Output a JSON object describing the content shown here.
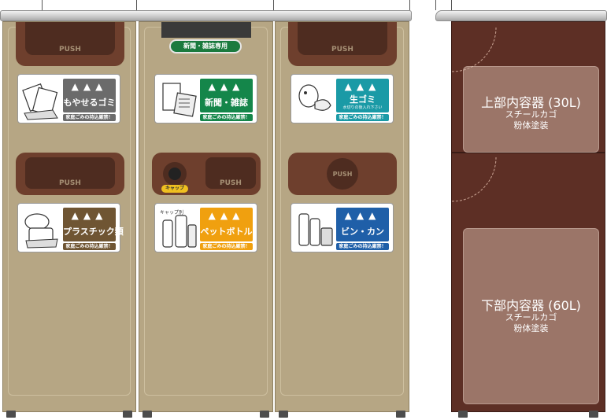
{
  "units": [
    {
      "id": "burnable",
      "upper_push": "PUSH",
      "lower_push": "PUSH",
      "label_text": "もやせるゴミ",
      "label_color": "#6b6b6b",
      "label_foot": "家庭ごみの持込厳禁！"
    },
    {
      "id": "newspaper",
      "tag": "新聞・雑誌専用",
      "cap_tag": "キャップ",
      "lower_push": "PUSH",
      "upper_label_text": "新聞・雑誌",
      "upper_label_color": "#14864a",
      "upper_label_foot": "家庭ごみの持込厳禁！",
      "lower_label_text": "ペットボトル",
      "lower_label_color": "#f0a00f",
      "lower_label_small": "キャップ別",
      "lower_label_foot": "家庭ごみの持込厳禁！"
    },
    {
      "id": "kitchen",
      "upper_push": "PUSH",
      "lower_push": "PUSH",
      "upper_label_text": "生ゴミ",
      "upper_label_sub": "水切りの後入れ下さい",
      "upper_label_color": "#1a9aa6",
      "upper_label_foot": "家庭ごみの持込厳禁！",
      "lower_label_text": "ビン・カン",
      "lower_label_color": "#1f5fa8",
      "lower_label_foot": "家庭ごみの持込厳禁！"
    }
  ],
  "burnable_lower_label": {
    "text": "プラスチック類",
    "color": "#6f5533",
    "foot": "家庭ごみの持込厳禁！"
  },
  "side_view": {
    "upper": {
      "title": "上部内容器 (30L)",
      "material": "スチールカゴ",
      "finish": "粉体塗装"
    },
    "lower": {
      "title": "下部内容器 (60L)",
      "material": "スチールカゴ",
      "finish": "粉体塗装"
    }
  },
  "colors": {
    "body": "#b6a684",
    "slot": "#6e3f2d",
    "side": "#5d2f25"
  }
}
